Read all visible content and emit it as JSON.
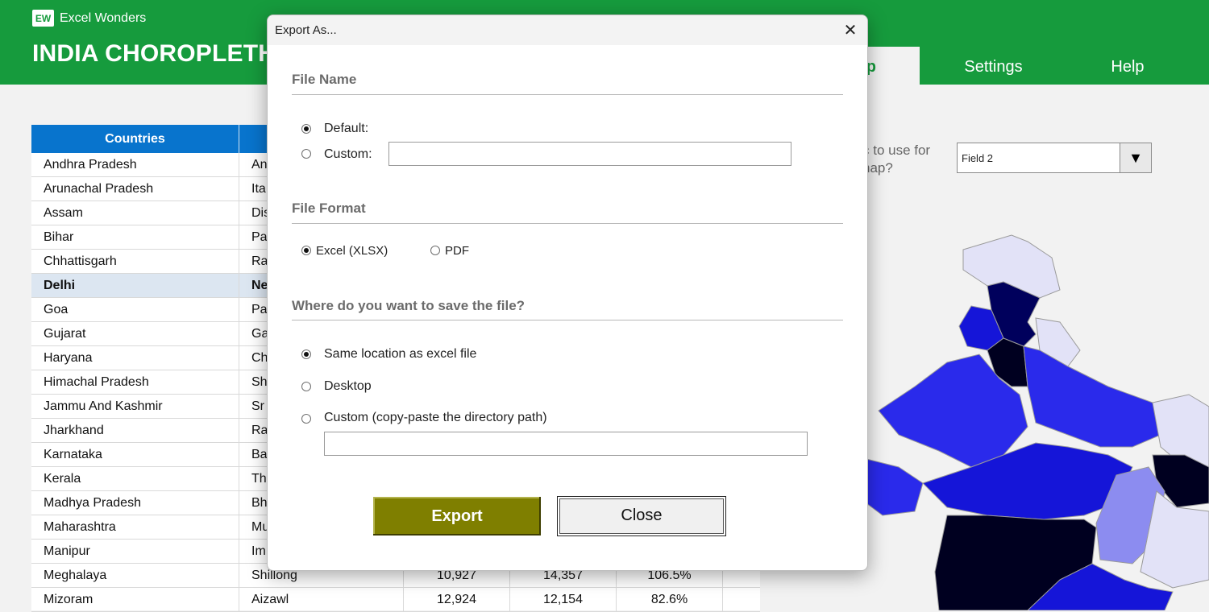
{
  "brand": {
    "logo_text": "EW",
    "name": "Excel Wonders"
  },
  "page_title": "INDIA CHOROPLETH",
  "tabs": [
    {
      "label": "p",
      "active": true
    },
    {
      "label": "Settings",
      "active": false
    },
    {
      "label": "Help",
      "active": false
    }
  ],
  "table": {
    "headers": [
      "Countries",
      "",
      "",
      "",
      ""
    ],
    "rows": [
      {
        "name": "Andhra Pradesh",
        "capital": "An",
        "v1": "",
        "v2": "",
        "v3": ""
      },
      {
        "name": "Arunachal Pradesh",
        "capital": "Ita",
        "v1": "",
        "v2": "",
        "v3": ""
      },
      {
        "name": "Assam",
        "capital": "Dis",
        "v1": "",
        "v2": "",
        "v3": ""
      },
      {
        "name": "Bihar",
        "capital": "Pa",
        "v1": "",
        "v2": "",
        "v3": ""
      },
      {
        "name": "Chhattisgarh",
        "capital": "Ra",
        "v1": "",
        "v2": "",
        "v3": ""
      },
      {
        "name": "Delhi",
        "capital": "Ne",
        "v1": "",
        "v2": "",
        "v3": "",
        "highlight": true
      },
      {
        "name": "Goa",
        "capital": "Pa",
        "v1": "",
        "v2": "",
        "v3": ""
      },
      {
        "name": "Gujarat",
        "capital": "Ga",
        "v1": "",
        "v2": "",
        "v3": ""
      },
      {
        "name": "Haryana",
        "capital": "Ch",
        "v1": "",
        "v2": "",
        "v3": ""
      },
      {
        "name": "Himachal Pradesh",
        "capital": "Sh",
        "v1": "",
        "v2": "",
        "v3": ""
      },
      {
        "name": "Jammu And Kashmir",
        "capital": "Sr",
        "v1": "",
        "v2": "",
        "v3": ""
      },
      {
        "name": "Jharkhand",
        "capital": "Ra",
        "v1": "",
        "v2": "",
        "v3": ""
      },
      {
        "name": "Karnataka",
        "capital": "Ba",
        "v1": "",
        "v2": "",
        "v3": ""
      },
      {
        "name": "Kerala",
        "capital": "Th",
        "v1": "",
        "v2": "",
        "v3": ""
      },
      {
        "name": "Madhya Pradesh",
        "capital": "Bh",
        "v1": "",
        "v2": "",
        "v3": ""
      },
      {
        "name": "Maharashtra",
        "capital": "Mu",
        "v1": "",
        "v2": "",
        "v3": ""
      },
      {
        "name": "Manipur",
        "capital": "Im",
        "v1": "",
        "v2": "",
        "v3": ""
      },
      {
        "name": "Meghalaya",
        "capital": "Shillong",
        "v1": "10,927",
        "v2": "14,357",
        "v3": "106.5%"
      },
      {
        "name": "Mizoram",
        "capital": "Aizawl",
        "v1": "12,924",
        "v2": "12,154",
        "v3": "82.6%"
      }
    ]
  },
  "field_question": "c to use for\nnap?",
  "field_select": {
    "value": "Field 2",
    "icon": "triangle-down-icon"
  },
  "map_colors": {
    "lightest": "#e2e2f7",
    "light": "#8c8cf0",
    "mid": "#2a2aeb",
    "strong": "#1515d8",
    "dark": "#00005c",
    "darkest": "#000020"
  },
  "dialog": {
    "title": "Export As...",
    "close_glyph": "✕",
    "file_name": {
      "heading": "File Name",
      "default_label": "Default:",
      "custom_label": "Custom:",
      "custom_value": "",
      "selected": "default"
    },
    "file_format": {
      "heading": "File Format",
      "excel_label": "Excel (XLSX)",
      "pdf_label": "PDF",
      "selected": "excel"
    },
    "save_location": {
      "heading": "Where do you want to save the file?",
      "same_label": "Same location as excel file",
      "desktop_label": "Desktop",
      "custom_label": "Custom (copy-paste the directory path)",
      "custom_value": "",
      "selected": "same"
    },
    "export_label": "Export",
    "close_label": "Close"
  }
}
